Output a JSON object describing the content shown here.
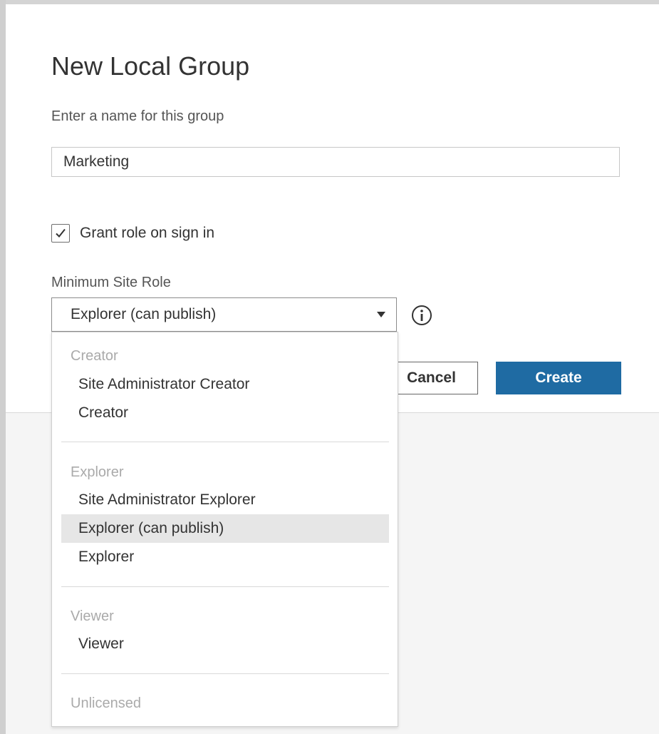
{
  "dialog": {
    "title": "New Local Group",
    "name_prompt": "Enter a name for this group",
    "name_value": "Marketing",
    "grant_role_label": "Grant role on sign in",
    "grant_role_checked": true,
    "min_role_label": "Minimum Site Role",
    "selected_role": "Explorer (can publish)",
    "cancel_label": "Cancel",
    "create_label": "Create"
  },
  "dropdown": {
    "groups": [
      {
        "header": "Creator",
        "options": [
          "Site Administrator Creator",
          "Creator"
        ]
      },
      {
        "header": "Explorer",
        "options": [
          "Site Administrator Explorer",
          "Explorer (can publish)",
          "Explorer"
        ]
      },
      {
        "header": "Viewer",
        "options": [
          "Viewer"
        ]
      },
      {
        "header": "Unlicensed",
        "options": []
      }
    ],
    "selected_option": "Explorer (can publish)"
  },
  "colors": {
    "primary_button": "#1f6ba3",
    "selected_option_bg": "#e6e6e6",
    "group_header_text": "#aaaaaa"
  },
  "icons": [
    "checkmark-icon",
    "dropdown-arrow-icon",
    "info-icon"
  ]
}
